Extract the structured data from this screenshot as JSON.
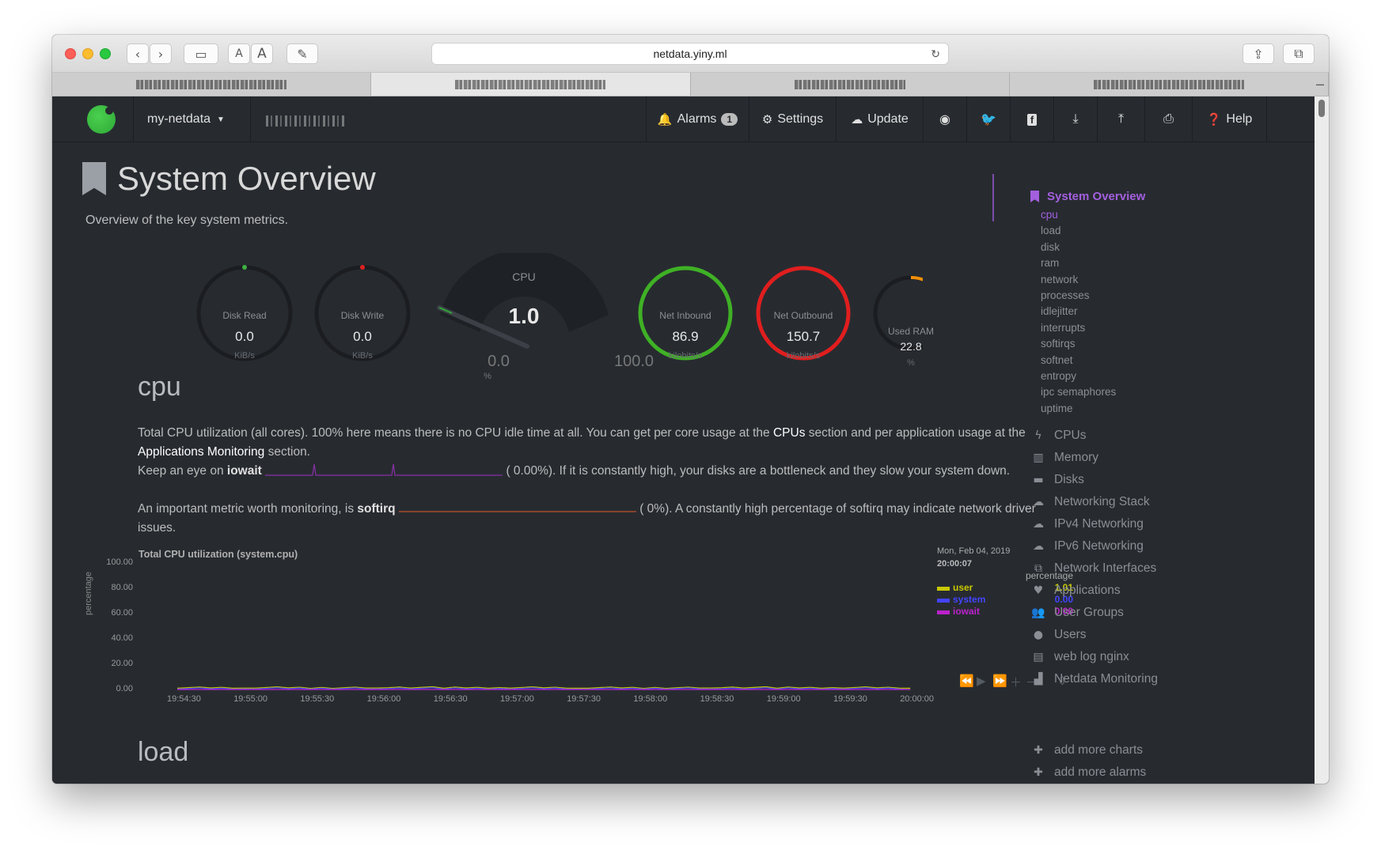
{
  "browser": {
    "url": "netdata.yiny.ml",
    "tabs": [
      "",
      "",
      "",
      ""
    ]
  },
  "navbar": {
    "server_name": "my-netdata",
    "alarms_label": "Alarms",
    "alarms_count": "1",
    "settings_label": "Settings",
    "update_label": "Update",
    "help_label": "Help"
  },
  "page": {
    "title": "System Overview",
    "subtitle": "Overview of the key system metrics."
  },
  "gauges": {
    "disk_read": {
      "label": "Disk Read",
      "value": "0.0",
      "unit": "KiB/s"
    },
    "disk_write": {
      "label": "Disk Write",
      "value": "0.0",
      "unit": "KiB/s"
    },
    "cpu": {
      "label": "CPU",
      "value": "1.0",
      "min": "0.0",
      "max": "100.0",
      "unit": "%",
      "fraction": 0.01
    },
    "net_inbound": {
      "label": "Net Inbound",
      "value": "86.9",
      "unit": "kilobits/s"
    },
    "net_outbound": {
      "label": "Net Outbound",
      "value": "150.7",
      "unit": "kilobits/s"
    },
    "used_ram": {
      "label": "Used RAM",
      "value": "22.8",
      "unit": "%",
      "fraction": 0.228
    }
  },
  "cpu_section": {
    "heading": "cpu",
    "p1_a": "Total CPU utilization (all cores). 100% here means there is no CPU idle time at all. You can get per core usage at the ",
    "p1_cpus": "CPUs",
    "p1_b": " section and per application usage at the ",
    "p1_apps": "Applications Monitoring",
    "p1_c": " section.",
    "p2_a": "Keep an eye on ",
    "p2_iowait": "iowait",
    "p2_b": "(      0.00%). If it is constantly high, your disks are a bottleneck and they slow your system down.",
    "p3_a": "An important metric worth monitoring, is ",
    "p3_softirq": "softirq",
    "p3_b": "(          0%). A constantly high percentage of softirq may indicate network driver issues."
  },
  "chart": {
    "title": "Total CPU utilization (system.cpu)",
    "ylabel": "percentage",
    "date": "Mon, Feb 04, 2019",
    "time": "20:00:07",
    "legend_header": "percentage",
    "legend": [
      {
        "name": "user",
        "value": "1.01",
        "color": "#c8c800"
      },
      {
        "name": "system",
        "value": "0.00",
        "color": "#4444ff"
      },
      {
        "name": "iowait",
        "value": "0.00",
        "color": "#bb22cc"
      }
    ]
  },
  "chart_data": {
    "type": "line",
    "title": "Total CPU utilization (system.cpu)",
    "ylabel": "percentage",
    "ylim": [
      0,
      100
    ],
    "yticks": [
      "100.00",
      "80.00",
      "60.00",
      "40.00",
      "20.00",
      "0.00"
    ],
    "x": [
      "19:54:30",
      "19:55:00",
      "19:55:30",
      "19:56:00",
      "19:56:30",
      "19:57:00",
      "19:57:30",
      "19:58:00",
      "19:58:30",
      "19:59:00",
      "19:59:30",
      "20:00:00"
    ],
    "series": [
      {
        "name": "user",
        "values": [
          1.0,
          1.1,
          0.9,
          1.2,
          1.0,
          1.1,
          1.0,
          0.9,
          1.2,
          1.0,
          1.1,
          1.01
        ]
      },
      {
        "name": "system",
        "values": [
          0.3,
          0.4,
          0.3,
          0.5,
          0.3,
          0.4,
          0.3,
          0.3,
          0.4,
          0.3,
          0.4,
          0.0
        ]
      },
      {
        "name": "iowait",
        "values": [
          0,
          0,
          0,
          0,
          0,
          0,
          0,
          0,
          0,
          0,
          0,
          0
        ]
      }
    ]
  },
  "load_section": {
    "heading": "load"
  },
  "sidebar": {
    "top": "System Overview",
    "subs": [
      "cpu",
      "load",
      "disk",
      "ram",
      "network",
      "processes",
      "idlejitter",
      "interrupts",
      "softirqs",
      "softnet",
      "entropy",
      "ipc semaphores",
      "uptime"
    ],
    "mains": [
      {
        "label": "CPUs",
        "icon": "bolt-icon",
        "glyph": "ϟ"
      },
      {
        "label": "Memory",
        "icon": "memory-icon",
        "glyph": "▥"
      },
      {
        "label": "Disks",
        "icon": "hdd-icon",
        "glyph": "▬"
      },
      {
        "label": "Networking Stack",
        "icon": "cloud-icon",
        "glyph": "☁"
      },
      {
        "label": "IPv4 Networking",
        "icon": "cloud-icon",
        "glyph": "☁"
      },
      {
        "label": "IPv6 Networking",
        "icon": "cloud-icon",
        "glyph": "☁"
      },
      {
        "label": "Network Interfaces",
        "icon": "sitemap-icon",
        "glyph": "⧉"
      },
      {
        "label": "Applications",
        "icon": "heartbeat-icon",
        "glyph": "♥"
      },
      {
        "label": "User Groups",
        "icon": "users-icon",
        "glyph": "👥"
      },
      {
        "label": "Users",
        "icon": "user-icon",
        "glyph": "●"
      },
      {
        "label": "web log nginx",
        "icon": "file-icon",
        "glyph": "▤"
      },
      {
        "label": "Netdata Monitoring",
        "icon": "bar-chart-icon",
        "glyph": "▟"
      }
    ],
    "add_charts": "add more charts",
    "add_alarms": "add more alarms"
  }
}
